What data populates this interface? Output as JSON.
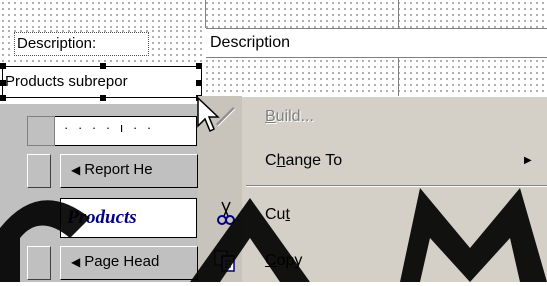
{
  "report_design": {
    "description_label": "Description:",
    "description_field": "Description",
    "subreport_label": "Products subrepor",
    "ruler_marks": "· · · · ı · ·",
    "band_report_header": "Report He",
    "band_page_header": "Page Head",
    "products_title": "Products"
  },
  "context_menu": {
    "items": [
      {
        "label_pre": "",
        "label_u": "B",
        "label_post": "uild...",
        "enabled": false
      },
      {
        "label_pre": "C",
        "label_u": "h",
        "label_post": "ange To",
        "enabled": true,
        "submenu_arrow": "▶"
      },
      {
        "label_pre": "Cu",
        "label_u": "t",
        "label_post": "",
        "enabled": true,
        "icon": "cut-icon"
      },
      {
        "label_pre": "",
        "label_u": "C",
        "label_post": "opy",
        "enabled": true,
        "icon": "copy-icon"
      }
    ]
  },
  "colors": {
    "menu_bg": "#d4d0c8",
    "panel_gray": "#c0c0c0",
    "products_title": "#000080",
    "disabled_text": "#808080"
  }
}
